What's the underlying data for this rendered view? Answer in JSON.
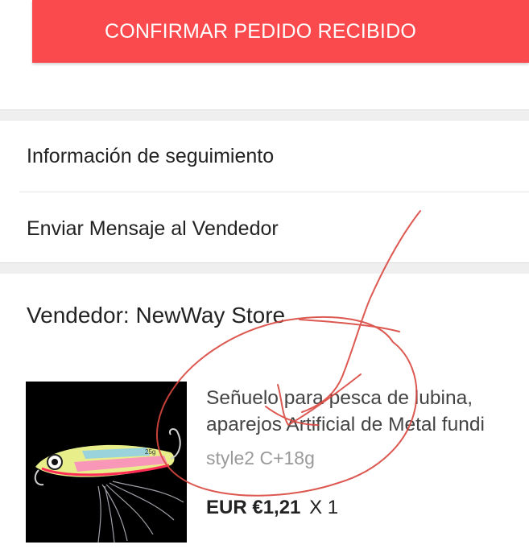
{
  "confirm_button": {
    "label": "CONFIRMAR PEDIDO RECIBIDO"
  },
  "menu": {
    "items": [
      {
        "label": "Información de seguimiento"
      },
      {
        "label": "Enviar Mensaje al Vendedor"
      }
    ]
  },
  "seller": {
    "label": "Vendedor: NewWay Store"
  },
  "product": {
    "title_line1": "Señuelo para pesca de lubina,",
    "title_line2": "aparejos Artificial de Metal fundi",
    "variant": "style2 C+18g",
    "price": "EUR €1,21",
    "quantity": "X 1",
    "image_label": "25g"
  },
  "colors": {
    "accent": "#fb4a4e",
    "annotation": "#d9473f"
  }
}
